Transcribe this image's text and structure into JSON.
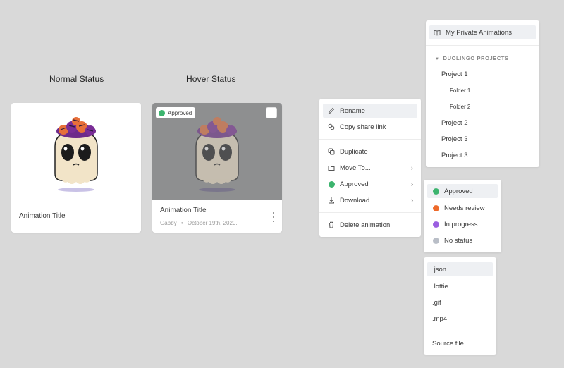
{
  "labels": {
    "normal": "Normal Status",
    "hover": "Hover Status"
  },
  "card_normal": {
    "title": "Animation Title"
  },
  "card_hover": {
    "badge": "Approved",
    "title": "Animation Title",
    "author": "Gabby",
    "separator": "•",
    "date": "October 19th, 2020."
  },
  "context_menu": {
    "items": [
      {
        "label": "Rename",
        "icon": "pencil-icon"
      },
      {
        "label": "Copy share link",
        "icon": "link-icon"
      },
      {
        "label": "Duplicate",
        "icon": "copy-icon"
      },
      {
        "label": "Move To...",
        "icon": "folder-move-icon"
      },
      {
        "label": "Approved",
        "icon": "status-dot"
      },
      {
        "label": "Download...",
        "icon": "download-icon"
      },
      {
        "label": "Delete animation",
        "icon": "trash-icon"
      }
    ]
  },
  "move_menu": {
    "private": "My Private Animations",
    "section": "DUOLINGO PROJECTS",
    "projects": [
      "Project 1",
      "Folder 1",
      "Folder 2",
      "Project 2",
      "Project 3",
      "Project 3"
    ]
  },
  "status_menu": {
    "items": [
      {
        "label": "Approved",
        "color": "#3cb46e"
      },
      {
        "label": "Needs review",
        "color": "#ee6a2a"
      },
      {
        "label": "In progress",
        "color": "#9b5fe0"
      },
      {
        "label": "No status",
        "color": "#b9bec7"
      }
    ]
  },
  "download_menu": {
    "items": [
      ".json",
      ".lottie",
      ".gif",
      ".mp4"
    ],
    "source": "Source file"
  },
  "colors": {
    "approved": "#3cb46e",
    "highlight": "#eef0f3",
    "hover_overlay": "#8e8f90"
  }
}
